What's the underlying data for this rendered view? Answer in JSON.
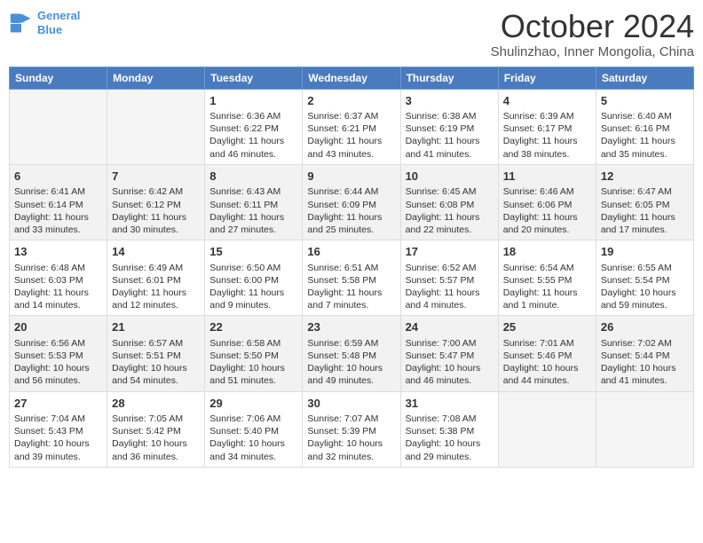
{
  "header": {
    "logo_line1": "General",
    "logo_line2": "Blue",
    "month_year": "October 2024",
    "location": "Shulinzhao, Inner Mongolia, China"
  },
  "weekdays": [
    "Sunday",
    "Monday",
    "Tuesday",
    "Wednesday",
    "Thursday",
    "Friday",
    "Saturday"
  ],
  "weeks": [
    [
      {
        "day": "",
        "info": ""
      },
      {
        "day": "",
        "info": ""
      },
      {
        "day": "1",
        "info": "Sunrise: 6:36 AM\nSunset: 6:22 PM\nDaylight: 11 hours and 46 minutes."
      },
      {
        "day": "2",
        "info": "Sunrise: 6:37 AM\nSunset: 6:21 PM\nDaylight: 11 hours and 43 minutes."
      },
      {
        "day": "3",
        "info": "Sunrise: 6:38 AM\nSunset: 6:19 PM\nDaylight: 11 hours and 41 minutes."
      },
      {
        "day": "4",
        "info": "Sunrise: 6:39 AM\nSunset: 6:17 PM\nDaylight: 11 hours and 38 minutes."
      },
      {
        "day": "5",
        "info": "Sunrise: 6:40 AM\nSunset: 6:16 PM\nDaylight: 11 hours and 35 minutes."
      }
    ],
    [
      {
        "day": "6",
        "info": "Sunrise: 6:41 AM\nSunset: 6:14 PM\nDaylight: 11 hours and 33 minutes."
      },
      {
        "day": "7",
        "info": "Sunrise: 6:42 AM\nSunset: 6:12 PM\nDaylight: 11 hours and 30 minutes."
      },
      {
        "day": "8",
        "info": "Sunrise: 6:43 AM\nSunset: 6:11 PM\nDaylight: 11 hours and 27 minutes."
      },
      {
        "day": "9",
        "info": "Sunrise: 6:44 AM\nSunset: 6:09 PM\nDaylight: 11 hours and 25 minutes."
      },
      {
        "day": "10",
        "info": "Sunrise: 6:45 AM\nSunset: 6:08 PM\nDaylight: 11 hours and 22 minutes."
      },
      {
        "day": "11",
        "info": "Sunrise: 6:46 AM\nSunset: 6:06 PM\nDaylight: 11 hours and 20 minutes."
      },
      {
        "day": "12",
        "info": "Sunrise: 6:47 AM\nSunset: 6:05 PM\nDaylight: 11 hours and 17 minutes."
      }
    ],
    [
      {
        "day": "13",
        "info": "Sunrise: 6:48 AM\nSunset: 6:03 PM\nDaylight: 11 hours and 14 minutes."
      },
      {
        "day": "14",
        "info": "Sunrise: 6:49 AM\nSunset: 6:01 PM\nDaylight: 11 hours and 12 minutes."
      },
      {
        "day": "15",
        "info": "Sunrise: 6:50 AM\nSunset: 6:00 PM\nDaylight: 11 hours and 9 minutes."
      },
      {
        "day": "16",
        "info": "Sunrise: 6:51 AM\nSunset: 5:58 PM\nDaylight: 11 hours and 7 minutes."
      },
      {
        "day": "17",
        "info": "Sunrise: 6:52 AM\nSunset: 5:57 PM\nDaylight: 11 hours and 4 minutes."
      },
      {
        "day": "18",
        "info": "Sunrise: 6:54 AM\nSunset: 5:55 PM\nDaylight: 11 hours and 1 minute."
      },
      {
        "day": "19",
        "info": "Sunrise: 6:55 AM\nSunset: 5:54 PM\nDaylight: 10 hours and 59 minutes."
      }
    ],
    [
      {
        "day": "20",
        "info": "Sunrise: 6:56 AM\nSunset: 5:53 PM\nDaylight: 10 hours and 56 minutes."
      },
      {
        "day": "21",
        "info": "Sunrise: 6:57 AM\nSunset: 5:51 PM\nDaylight: 10 hours and 54 minutes."
      },
      {
        "day": "22",
        "info": "Sunrise: 6:58 AM\nSunset: 5:50 PM\nDaylight: 10 hours and 51 minutes."
      },
      {
        "day": "23",
        "info": "Sunrise: 6:59 AM\nSunset: 5:48 PM\nDaylight: 10 hours and 49 minutes."
      },
      {
        "day": "24",
        "info": "Sunrise: 7:00 AM\nSunset: 5:47 PM\nDaylight: 10 hours and 46 minutes."
      },
      {
        "day": "25",
        "info": "Sunrise: 7:01 AM\nSunset: 5:46 PM\nDaylight: 10 hours and 44 minutes."
      },
      {
        "day": "26",
        "info": "Sunrise: 7:02 AM\nSunset: 5:44 PM\nDaylight: 10 hours and 41 minutes."
      }
    ],
    [
      {
        "day": "27",
        "info": "Sunrise: 7:04 AM\nSunset: 5:43 PM\nDaylight: 10 hours and 39 minutes."
      },
      {
        "day": "28",
        "info": "Sunrise: 7:05 AM\nSunset: 5:42 PM\nDaylight: 10 hours and 36 minutes."
      },
      {
        "day": "29",
        "info": "Sunrise: 7:06 AM\nSunset: 5:40 PM\nDaylight: 10 hours and 34 minutes."
      },
      {
        "day": "30",
        "info": "Sunrise: 7:07 AM\nSunset: 5:39 PM\nDaylight: 10 hours and 32 minutes."
      },
      {
        "day": "31",
        "info": "Sunrise: 7:08 AM\nSunset: 5:38 PM\nDaylight: 10 hours and 29 minutes."
      },
      {
        "day": "",
        "info": ""
      },
      {
        "day": "",
        "info": ""
      }
    ]
  ]
}
